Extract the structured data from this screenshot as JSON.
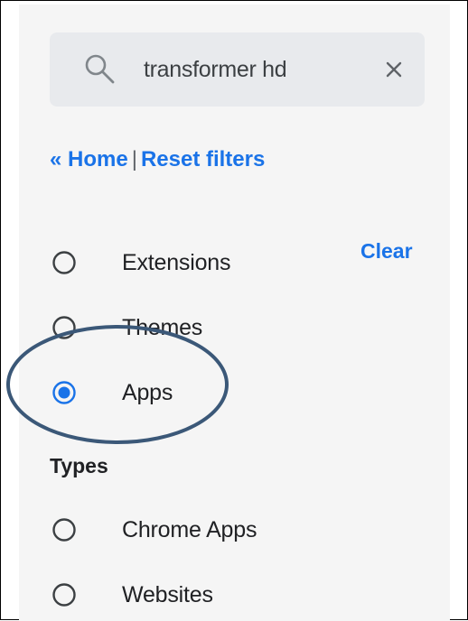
{
  "search": {
    "value": "transformer hd"
  },
  "breadcrumb": {
    "home_label": "« Home",
    "separator": "|",
    "reset_label": "Reset filters"
  },
  "category_filter": {
    "clear_label": "Clear",
    "options": [
      {
        "label": "Extensions",
        "selected": false
      },
      {
        "label": "Themes",
        "selected": false
      },
      {
        "label": "Apps",
        "selected": true
      }
    ]
  },
  "types_filter": {
    "heading": "Types",
    "options": [
      {
        "label": "Chrome Apps",
        "selected": false
      },
      {
        "label": "Websites",
        "selected": false
      }
    ]
  },
  "icons": {
    "search": "search-icon",
    "clear": "close-icon",
    "radio_on": "radio-selected-icon",
    "radio_off": "radio-unselected-icon"
  },
  "colors": {
    "accent": "#1a73e8",
    "panel_bg": "#f5f5f5",
    "search_bg": "#e8eaed",
    "annotation_ellipse": "#3b5878"
  }
}
